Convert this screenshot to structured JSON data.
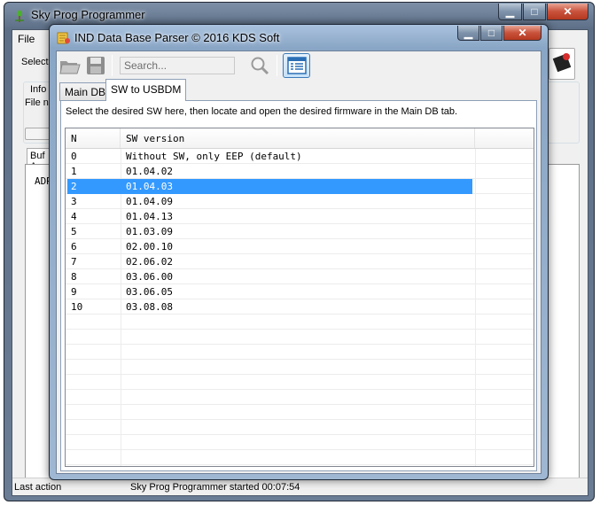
{
  "main_window": {
    "title": "Sky Prog Programmer",
    "menu": [
      "File"
    ],
    "side_labels": [
      "Selecte",
      "Info I",
      "File no"
    ],
    "buffer_tab": "Buf A",
    "buffer_column": "ADR",
    "status": {
      "label": "Last action",
      "message": "Sky Prog Programmer started 00:07:54"
    }
  },
  "dialog": {
    "title": "IND Data Base Parser © 2016 KDS Soft",
    "search_placeholder": "Search...",
    "tabs": [
      {
        "label": "Main DB",
        "active": false
      },
      {
        "label": "SW to USBDM",
        "active": true
      }
    ],
    "instruction": "Select the desired SW here, then locate and open the desired firmware in the Main DB tab.",
    "grid": {
      "columns": [
        "N",
        "SW version"
      ],
      "rows": [
        {
          "n": "0",
          "sw": "Without SW, only EEP (default)"
        },
        {
          "n": "1",
          "sw": "01.04.02"
        },
        {
          "n": "2",
          "sw": "01.04.03"
        },
        {
          "n": "3",
          "sw": "01.04.09"
        },
        {
          "n": "4",
          "sw": "01.04.13"
        },
        {
          "n": "5",
          "sw": "01.03.09"
        },
        {
          "n": "6",
          "sw": "02.00.10"
        },
        {
          "n": "7",
          "sw": "02.06.02"
        },
        {
          "n": "8",
          "sw": "03.06.00"
        },
        {
          "n": "9",
          "sw": "03.06.05"
        },
        {
          "n": "10",
          "sw": "03.08.08"
        }
      ],
      "selected_row": 2
    }
  },
  "colors": {
    "selection": "#3399ff",
    "close_button": "#c9523c",
    "titlebar": "#8aa6c6"
  },
  "icons": [
    "sky-prog-app-icon",
    "database-parser-icon",
    "open-folder-icon",
    "save-disk-icon",
    "magnifier-icon",
    "list-view-icon",
    "chip-icon"
  ]
}
